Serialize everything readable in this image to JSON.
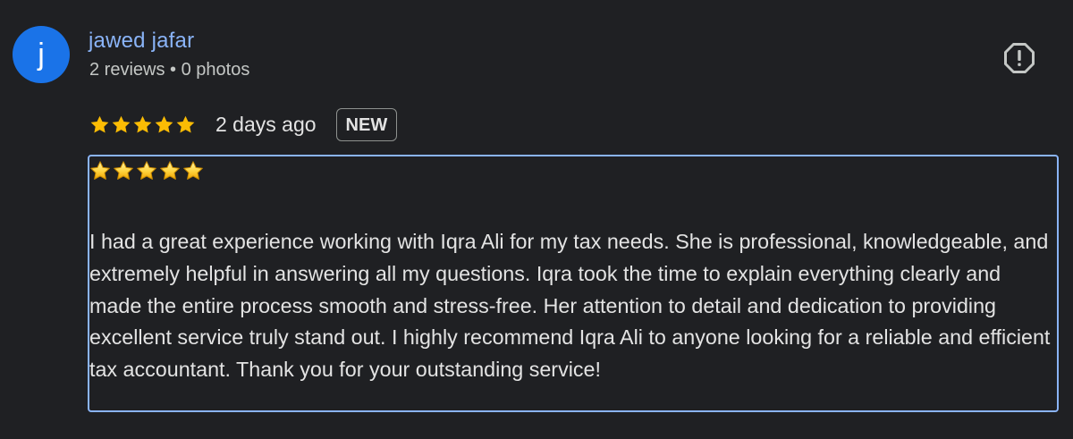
{
  "author": {
    "initial": "j",
    "name": "jawed jafar",
    "meta": "2 reviews • 0 photos"
  },
  "rating": {
    "stars": 5,
    "date": "2 days ago",
    "badge": "NEW"
  },
  "review": {
    "emoji_stars": 5,
    "text": "I had a great experience working with Iqra Ali for my tax needs. She is professional, knowledgeable, and extremely helpful in answering all my questions. Iqra took the time to explain everything clearly and made the entire process smooth and stress-free. Her attention to detail and dedication to providing excellent service truly stand out. I highly recommend Iqra Ali to anyone looking for a reliable and efficient tax accountant. Thank you for your outstanding service!"
  },
  "icons": {
    "report": "report-icon",
    "star": "star-icon"
  },
  "colors": {
    "background": "#1f2023",
    "avatar": "#1a73e8",
    "author_name": "#8ab4f8",
    "star": "#fbbc04",
    "focus_border": "#8ab4f8"
  }
}
